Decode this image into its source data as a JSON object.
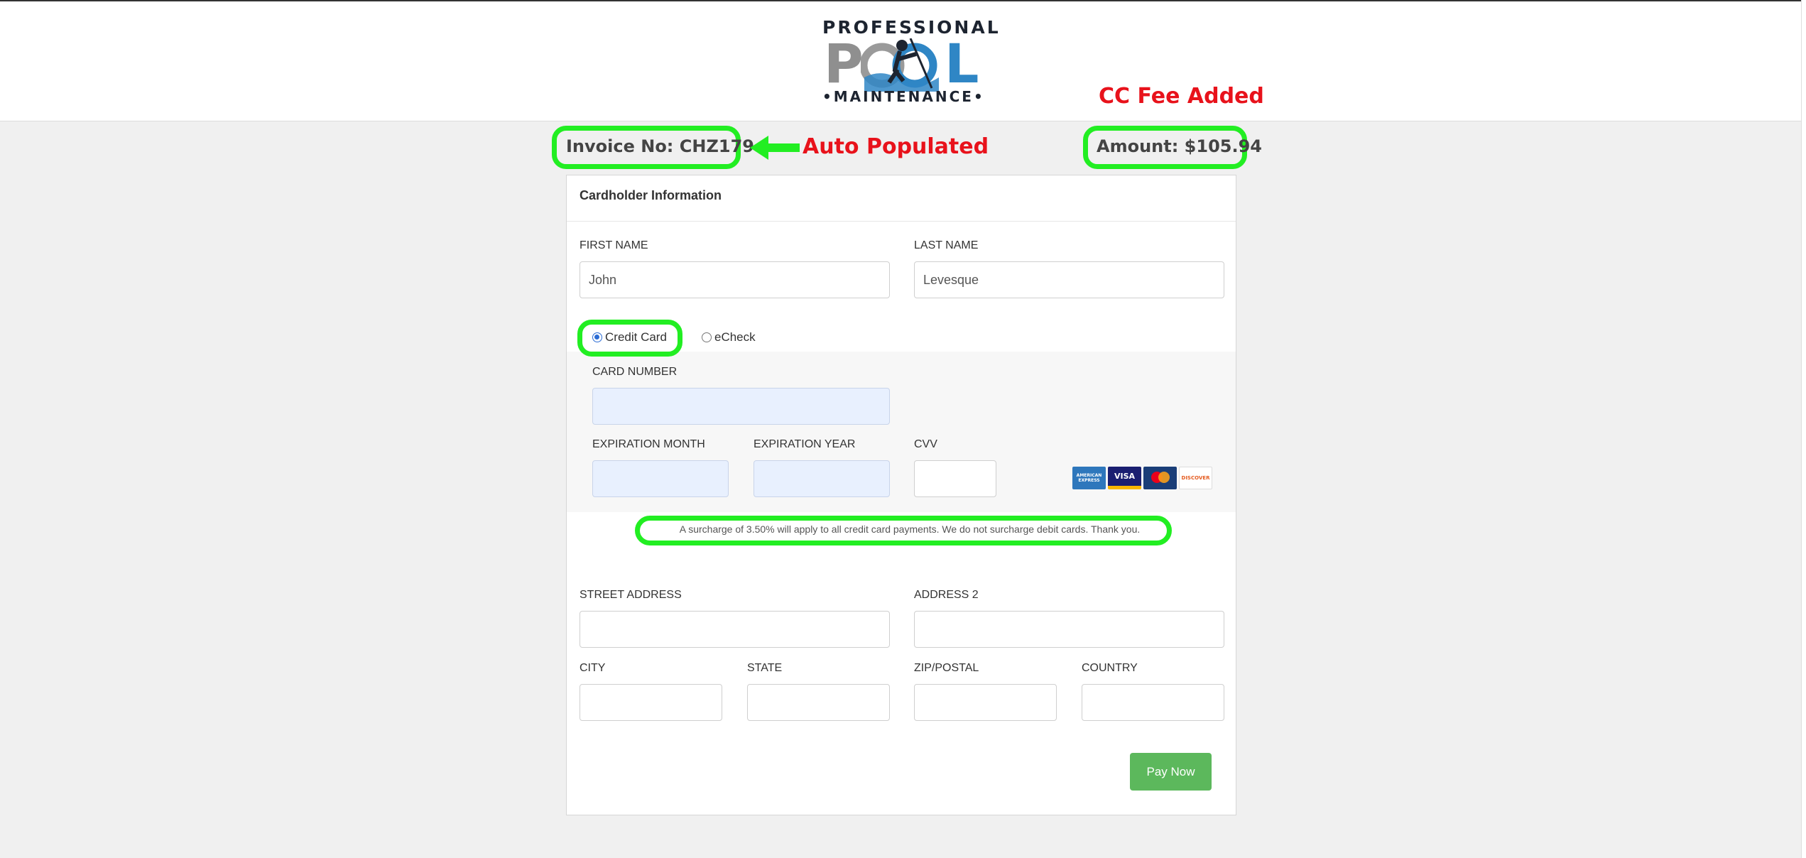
{
  "logo": {
    "top": "PROFESSIONAL",
    "pool": "POOL",
    "bottom": "•MAINTENANCE•"
  },
  "header": {
    "invoice": "Invoice No: CHZ179",
    "amount": "Amount: $105.94"
  },
  "annotations": {
    "auto_populated": "Auto Populated",
    "cc_fee": "CC Fee Added",
    "highlight_color": "#22ee22",
    "text_color": "#e8121b"
  },
  "form": {
    "section_title": "Cardholder Information",
    "first_name": {
      "label": "FIRST NAME",
      "value": "John"
    },
    "last_name": {
      "label": "LAST NAME",
      "value": "Levesque"
    },
    "payment_method": {
      "options": [
        "Credit Card",
        "eCheck"
      ],
      "selected": "Credit Card"
    },
    "card_number": {
      "label": "CARD NUMBER",
      "value": ""
    },
    "exp_month": {
      "label": "EXPIRATION MONTH",
      "value": ""
    },
    "exp_year": {
      "label": "EXPIRATION YEAR",
      "value": ""
    },
    "cvv": {
      "label": "CVV",
      "value": ""
    },
    "card_logos": [
      "AMERICAN EXPRESS",
      "VISA",
      "mastercard",
      "DISCOVER"
    ],
    "surcharge_note": "A surcharge of 3.50% will apply to all credit card payments. We do not surcharge debit cards. Thank you.",
    "street": {
      "label": "STREET ADDRESS",
      "value": ""
    },
    "address2": {
      "label": "ADDRESS 2",
      "value": ""
    },
    "city": {
      "label": "CITY",
      "value": ""
    },
    "state": {
      "label": "STATE",
      "value": ""
    },
    "zip": {
      "label": "ZIP/POSTAL",
      "value": ""
    },
    "country": {
      "label": "COUNTRY",
      "value": ""
    },
    "submit": "Pay Now"
  }
}
